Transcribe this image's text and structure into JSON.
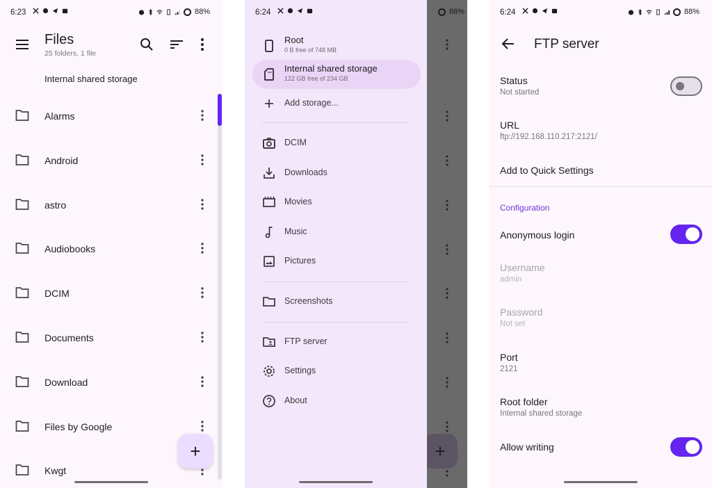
{
  "colors": {
    "accent": "#6524f0",
    "surface": "#fdf7fd",
    "drawer": "#f3e8fb",
    "drawer_active": "#ebd5f7",
    "fab": "#eaddff"
  },
  "panels": [
    {
      "status": {
        "time": "6:23",
        "battery": "88%"
      },
      "appbar": {
        "title": "Files",
        "subtitle": "25 folders, 1 file"
      },
      "breadcrumb": "Internal shared storage",
      "files": [
        {
          "name": "Alarms"
        },
        {
          "name": "Android"
        },
        {
          "name": "astro"
        },
        {
          "name": "Audiobooks"
        },
        {
          "name": "DCIM"
        },
        {
          "name": "Documents"
        },
        {
          "name": "Download"
        },
        {
          "name": "Files by Google"
        },
        {
          "name": "Kwgt"
        }
      ],
      "fab_label": "+"
    },
    {
      "status": {
        "time": "6:24",
        "battery": "88%"
      },
      "drawer": {
        "storages": [
          {
            "label": "Root",
            "sub": "0 B free of 748 MB",
            "icon": "phone-icon"
          },
          {
            "label": "Internal shared storage",
            "sub": "122 GB free of 234 GB",
            "icon": "sd-card-icon",
            "active": true
          }
        ],
        "add_storage": "Add storage...",
        "bookmarks": [
          {
            "label": "DCIM",
            "icon": "camera-icon"
          },
          {
            "label": "Downloads",
            "icon": "download-icon"
          },
          {
            "label": "Movies",
            "icon": "movie-icon"
          },
          {
            "label": "Music",
            "icon": "music-note-icon"
          },
          {
            "label": "Pictures",
            "icon": "image-icon"
          }
        ],
        "custom": [
          {
            "label": "Screenshots",
            "icon": "folder-icon"
          }
        ],
        "tools": [
          {
            "label": "FTP server",
            "icon": "ftp-folder-icon"
          },
          {
            "label": "Settings",
            "icon": "gear-icon"
          },
          {
            "label": "About",
            "icon": "help-icon"
          }
        ]
      },
      "fab_label": "+"
    },
    {
      "status": {
        "time": "6:24",
        "battery": "88%"
      },
      "title": "FTP server",
      "status_pref": {
        "title": "Status",
        "summary": "Not started",
        "enabled": false
      },
      "url_pref": {
        "title": "URL",
        "summary": "ftp://192.168.110.217:2121/"
      },
      "quick_settings": "Add to Quick Settings",
      "section": "Configuration",
      "anonymous": {
        "title": "Anonymous login",
        "enabled": true
      },
      "username": {
        "title": "Username",
        "summary": "admin"
      },
      "password": {
        "title": "Password",
        "summary": "Not set"
      },
      "port": {
        "title": "Port",
        "summary": "2121"
      },
      "root_folder": {
        "title": "Root folder",
        "summary": "Internal shared storage"
      },
      "allow_writing": {
        "title": "Allow writing",
        "enabled": true
      }
    }
  ]
}
